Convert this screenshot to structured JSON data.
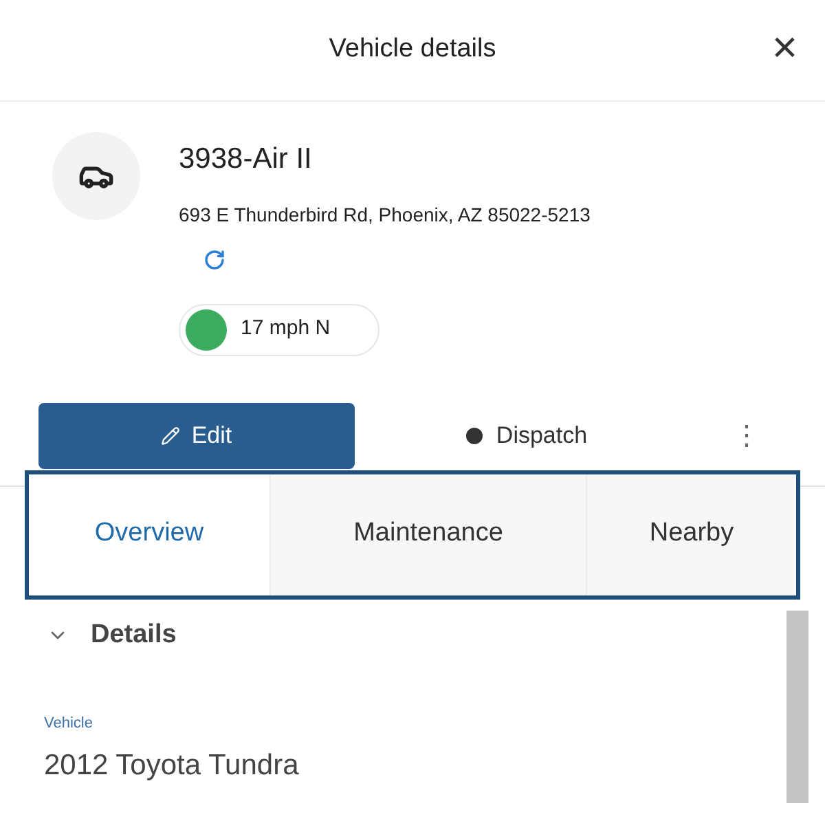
{
  "header": {
    "title": "Vehicle details",
    "close": "×"
  },
  "vehicle": {
    "name": "3938-Air II",
    "address": "693 E Thunderbird Rd, Phoenix, AZ 85022-5213",
    "status": {
      "color": "#3dab5f",
      "speed": "17 mph N"
    }
  },
  "actions": [
    {
      "kind": "primary",
      "label": "Edit"
    },
    {
      "kind": "secondary",
      "label": "Dispatch"
    },
    {
      "kind": "more",
      "label": "⋮"
    }
  ],
  "tabs": [
    {
      "label": "Overview",
      "selected": true
    },
    {
      "label": "Maintenance",
      "selected": false
    },
    {
      "label": "Nearby",
      "selected": false
    }
  ],
  "section": {
    "title": "Details",
    "expanded": true,
    "fields": [
      {
        "label": "Vehicle",
        "value": "2012 Toyota Tundra"
      }
    ]
  }
}
